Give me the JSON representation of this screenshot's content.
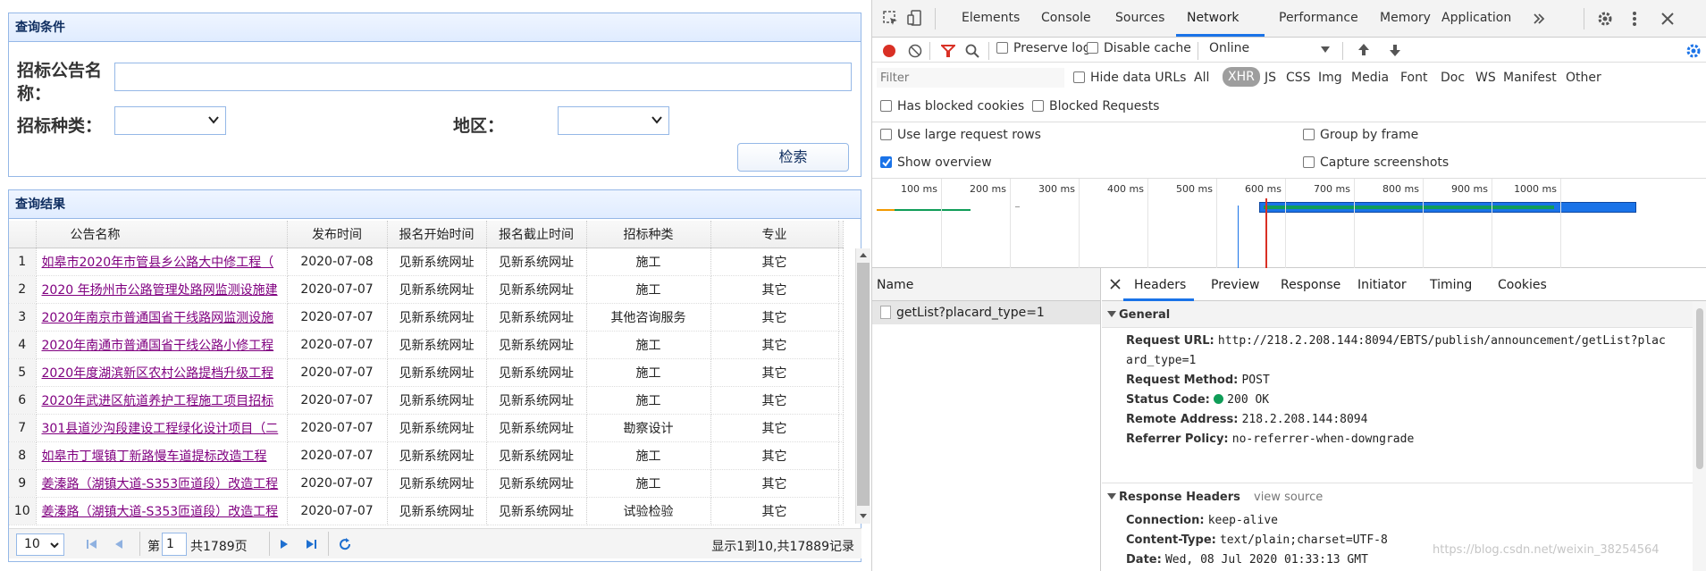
{
  "left": {
    "query_panel": {
      "title": "查询条件",
      "name_label": "招标公告名称：",
      "name_value": "",
      "type_label": "招标种类：",
      "type_value": "",
      "region_label": "地区：",
      "region_value": "",
      "search_button": "检索"
    },
    "results_panel": {
      "title": "查询结果",
      "columns": [
        "公告名称",
        "发布时间",
        "报名开始时间",
        "报名截止时间",
        "招标种类",
        "专业"
      ],
      "rows": [
        {
          "no": "1",
          "name": "如皋市2020年市管县乡公路大中修工程（",
          "date": "2020-07-08",
          "start": "见新系统网址",
          "end": "见新系统网址",
          "type": "施工",
          "major": "其它"
        },
        {
          "no": "2",
          "name": "2020 年扬州市公路管理处路网监测设施建",
          "date": "2020-07-07",
          "start": "见新系统网址",
          "end": "见新系统网址",
          "type": "施工",
          "major": "其它"
        },
        {
          "no": "3",
          "name": "2020年南京市普通国省干线路网监测设施",
          "date": "2020-07-07",
          "start": "见新系统网址",
          "end": "见新系统网址",
          "type": "其他咨询服务",
          "major": "其它"
        },
        {
          "no": "4",
          "name": "2020年南通市普通国省干线公路小修工程",
          "date": "2020-07-07",
          "start": "见新系统网址",
          "end": "见新系统网址",
          "type": "施工",
          "major": "其它"
        },
        {
          "no": "5",
          "name": "2020年度湖滨新区农村公路提档升级工程",
          "date": "2020-07-07",
          "start": "见新系统网址",
          "end": "见新系统网址",
          "type": "施工",
          "major": "其它"
        },
        {
          "no": "6",
          "name": "2020年武进区航道养护工程施工项目招标",
          "date": "2020-07-07",
          "start": "见新系统网址",
          "end": "见新系统网址",
          "type": "施工",
          "major": "其它"
        },
        {
          "no": "7",
          "name": "301县道沙沟段建设工程绿化设计项目（二",
          "date": "2020-07-07",
          "start": "见新系统网址",
          "end": "见新系统网址",
          "type": "勘察设计",
          "major": "其它"
        },
        {
          "no": "8",
          "name": "如皋市丁堰镇丁新路慢车道提标改造工程",
          "date": "2020-07-07",
          "start": "见新系统网址",
          "end": "见新系统网址",
          "type": "施工",
          "major": "其它"
        },
        {
          "no": "9",
          "name": "姜溱路（湖镇大道-S353匝道段）改造工程",
          "date": "2020-07-07",
          "start": "见新系统网址",
          "end": "见新系统网址",
          "type": "施工",
          "major": "其它"
        },
        {
          "no": "10",
          "name": "姜溱路（湖镇大道-S353匝道段）改造工程",
          "date": "2020-07-07",
          "start": "见新系统网址",
          "end": "见新系统网址",
          "type": "试验检验",
          "major": "其它"
        }
      ],
      "pager": {
        "page_size": "10",
        "page_prefix": "第",
        "page_value": "1",
        "page_total": "共1789页",
        "summary": "显示1到10,共17889记录"
      }
    }
  },
  "devtools": {
    "tabs": [
      "Elements",
      "Console",
      "Sources",
      "Network",
      "Performance",
      "Memory",
      "Application"
    ],
    "active_tab": "Network",
    "toolbar": {
      "preserve_log": "Preserve log",
      "disable_cache": "Disable cache",
      "throttle": "Online"
    },
    "filter": {
      "placeholder": "Filter",
      "hide_data_urls": "Hide data URLs",
      "types": [
        "All",
        "XHR",
        "JS",
        "CSS",
        "Img",
        "Media",
        "Font",
        "Doc",
        "WS",
        "Manifest",
        "Other"
      ],
      "active_type": "XHR",
      "has_blocked_cookies": "Has blocked cookies",
      "blocked_requests": "Blocked Requests"
    },
    "options": {
      "large_rows": "Use large request rows",
      "group_by_frame": "Group by frame",
      "show_overview": "Show overview",
      "capture_screenshots": "Capture screenshots"
    },
    "timeline_ticks": [
      "100 ms",
      "200 ms",
      "300 ms",
      "400 ms",
      "500 ms",
      "600 ms",
      "700 ms",
      "800 ms",
      "900 ms",
      "1000 ms"
    ],
    "requests_header": "Name",
    "requests": [
      "getList?placard_type=1"
    ],
    "detail_tabs": [
      "Headers",
      "Preview",
      "Response",
      "Initiator",
      "Timing",
      "Cookies"
    ],
    "active_detail_tab": "Headers",
    "general": {
      "title": "General",
      "request_url_label": "Request URL:",
      "request_url_line1": "http://218.2.208.144:8094/EBTS/publish/announcement/getList?plac",
      "request_url_line2": "ard_type=1",
      "method_label": "Request Method:",
      "method": "POST",
      "status_label": "Status Code:",
      "status": "200 OK",
      "remote_label": "Remote Address:",
      "remote": "218.2.208.144:8094",
      "referrer_label": "Referrer Policy:",
      "referrer": "no-referrer-when-downgrade"
    },
    "response_headers": {
      "title": "Response Headers",
      "view_source": "view source",
      "connection_label": "Connection:",
      "connection": "keep-alive",
      "content_type_label": "Content-Type:",
      "content_type": "text/plain;charset=UTF-8",
      "date_label": "Date:",
      "date": "Wed, 08 Jul 2020 01:33:13 GMT"
    },
    "watermark": "https://blog.csdn.net/weixin_38254564"
  }
}
